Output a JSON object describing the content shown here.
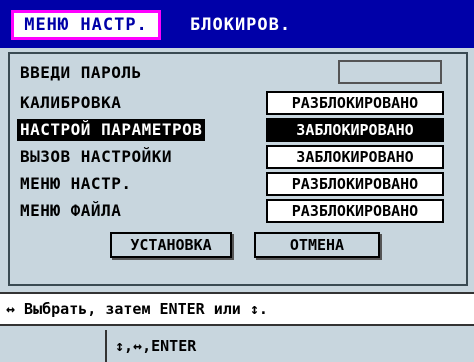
{
  "tabs": {
    "active": "МЕНЮ НАСТР.",
    "title": "БЛОКИРОВ."
  },
  "password": {
    "label": "ВВЕДИ ПАРОЛЬ",
    "value": ""
  },
  "rows": [
    {
      "label": "КАЛИБРОВКА",
      "value": "РАЗБЛОКИРОВАНО",
      "selected": false
    },
    {
      "label": "НАСТРОЙ ПАРАМЕТРОВ",
      "value": "ЗАБЛОКИРОВАНО",
      "selected": true
    },
    {
      "label": "ВЫЗОВ НАСТРОЙКИ",
      "value": "ЗАБЛОКИРОВАНО",
      "selected": false
    },
    {
      "label": "МЕНЮ НАСТР.",
      "value": "РАЗБЛОКИРОВАНО",
      "selected": false
    },
    {
      "label": "МЕНЮ ФАЙЛА",
      "value": "РАЗБЛОКИРОВАНО",
      "selected": false
    }
  ],
  "buttons": {
    "setup": "УСТАНОВКА",
    "cancel": "ОТМЕНА"
  },
  "hint": "↔ Выбрать, затем ENTER или ↕.",
  "status": "↕,↔,ENTER",
  "colors": {
    "header": "#0000a8",
    "tab_border": "#ff00ff",
    "panel": "#c8d6de"
  }
}
